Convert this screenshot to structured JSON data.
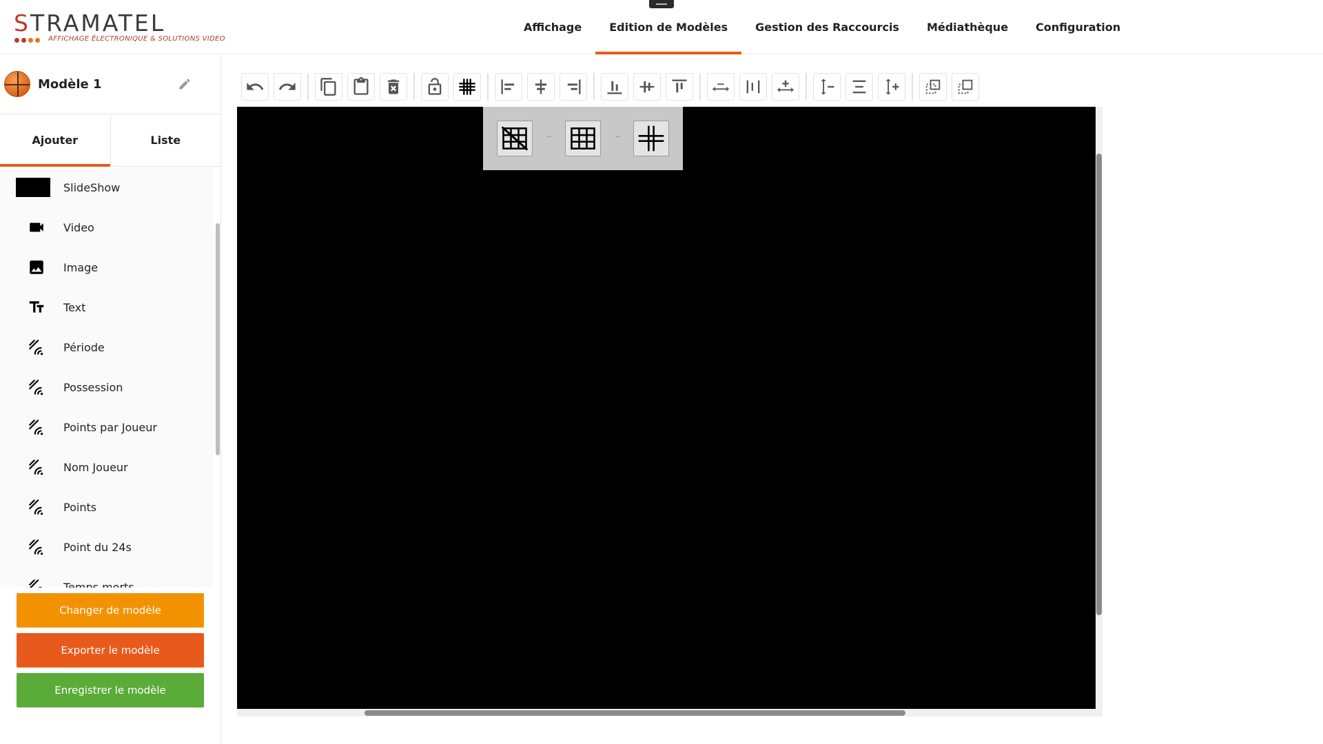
{
  "brand": {
    "name": "STRAMATEL",
    "tagline": "AFFICHAGE ÉLECTRONIQUE & SOLUTIONS VIDEO",
    "colors": {
      "red": "#c0392b",
      "dark": "#3a3a3a",
      "dot_orange": "#e8741b",
      "dot_red": "#c0392b"
    }
  },
  "nav": {
    "tabs": [
      {
        "label": "Affichage"
      },
      {
        "label": "Edition de Modèles"
      },
      {
        "label": "Gestion des Raccourcis"
      },
      {
        "label": "Médiathèque"
      },
      {
        "label": "Configuration"
      }
    ],
    "active": "Edition de Modèles",
    "accent": "#e85a1b"
  },
  "sidebar": {
    "model_name": "Modèle 1",
    "model_icon": "basketball-icon",
    "edit_icon": "pencil-icon",
    "tabs": [
      {
        "label": "Ajouter"
      },
      {
        "label": "Liste"
      }
    ],
    "active_tab": "Ajouter",
    "items": [
      {
        "label": "SlideShow",
        "icon": "slideshow-icon"
      },
      {
        "label": "Video",
        "icon": "video-camera-icon"
      },
      {
        "label": "Image",
        "icon": "image-icon"
      },
      {
        "label": "Text",
        "icon": "text-icon"
      },
      {
        "label": "Période",
        "icon": "scoreboard-signal-icon"
      },
      {
        "label": "Possession",
        "icon": "scoreboard-signal-icon"
      },
      {
        "label": "Points par Joueur",
        "icon": "scoreboard-signal-icon"
      },
      {
        "label": "Nom Joueur",
        "icon": "scoreboard-signal-icon"
      },
      {
        "label": "Points",
        "icon": "scoreboard-signal-icon"
      },
      {
        "label": "Point du 24s",
        "icon": "scoreboard-signal-icon"
      },
      {
        "label": "Temps morts",
        "icon": "scoreboard-signal-icon"
      }
    ],
    "buttons": {
      "change": {
        "label": "Changer de modèle",
        "color": "#f39200"
      },
      "export": {
        "label": "Exporter le modèle",
        "color": "#e85a1b"
      },
      "save": {
        "label": "Enregistrer le modèle",
        "color": "#5aab38"
      }
    }
  },
  "toolbar": {
    "groups": [
      [
        "undo-icon",
        "redo-icon"
      ],
      [
        "copy-icon",
        "paste-icon",
        "delete-icon"
      ],
      [
        "lock-icon",
        "grid-icon"
      ],
      [
        "align-left-icon",
        "align-center-horizontal-icon",
        "align-right-icon"
      ],
      [
        "align-bottom-icon",
        "align-middle-vertical-icon",
        "align-top-icon"
      ],
      [
        "distribute-horizontal-icon",
        "space-horizontal-icon",
        "stretch-horizontal-icon"
      ],
      [
        "height-decrease-icon",
        "distribute-vertical-icon",
        "height-increase-icon"
      ],
      [
        "send-backward-icon",
        "bring-forward-icon"
      ]
    ]
  },
  "grid_popup": {
    "options": [
      "no-grid-icon",
      "grid-icon",
      "guides-icon"
    ]
  },
  "canvas": {
    "background": "#000000"
  }
}
